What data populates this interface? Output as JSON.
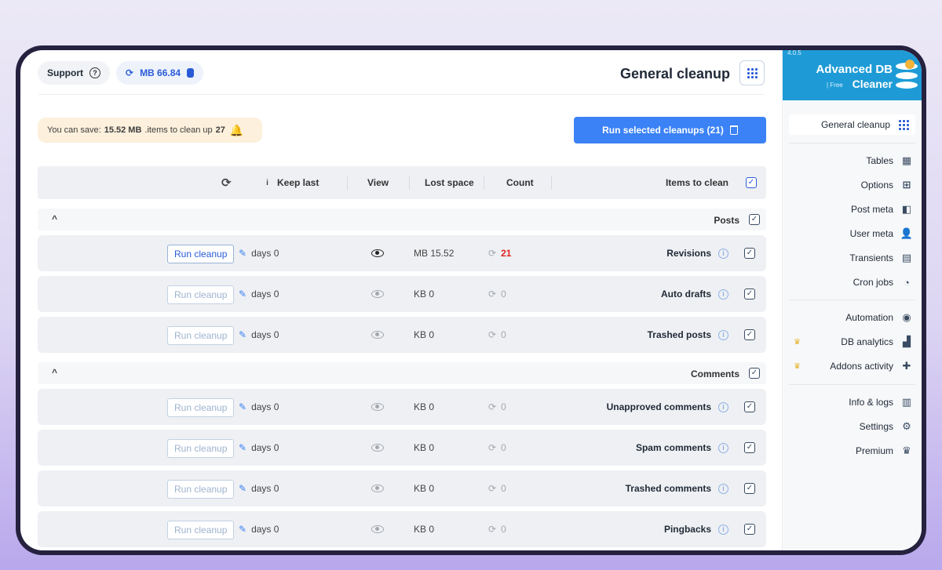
{
  "topbar": {
    "support_label": "Support",
    "db_size": "MB 66.84",
    "page_title": "General cleanup"
  },
  "banner": {
    "prefix": "You can save:",
    "save_amount": "15.52 MB",
    "middle": ".items to clean up",
    "items_count": "27"
  },
  "run_selected_label": "Run selected cleanups (21)",
  "table": {
    "headers": {
      "keep_last": "Keep last",
      "view": "View",
      "lost_space": "Lost space",
      "count": "Count",
      "items_to_clean": "Items to clean"
    },
    "run_label": "Run cleanup",
    "sections": [
      {
        "title": "Posts",
        "rows": [
          {
            "keep": "days 0",
            "space": "MB 15.52",
            "count": "21",
            "name": "Revisions"
          },
          {
            "keep": "days 0",
            "space": "KB 0",
            "count": "0",
            "name": "Auto drafts"
          },
          {
            "keep": "days 0",
            "space": "KB 0",
            "count": "0",
            "name": "Trashed posts"
          }
        ]
      },
      {
        "title": "Comments",
        "rows": [
          {
            "keep": "days 0",
            "space": "KB 0",
            "count": "0",
            "name": "Unapproved comments"
          },
          {
            "keep": "days 0",
            "space": "KB 0",
            "count": "0",
            "name": "Spam comments"
          },
          {
            "keep": "days 0",
            "space": "KB 0",
            "count": "0",
            "name": "Trashed comments"
          },
          {
            "keep": "days 0",
            "space": "KB 0",
            "count": "0",
            "name": "Pingbacks"
          }
        ]
      }
    ]
  },
  "sidebar": {
    "version": "4.0.5",
    "brand_line1": "Advanced DB",
    "brand_free": "| Free",
    "brand_line2": "Cleaner",
    "items": [
      {
        "label": "General cleanup",
        "icon": "grid-icon"
      },
      {
        "label": "Tables",
        "icon": "tables-icon"
      },
      {
        "label": "Options",
        "icon": "options-icon"
      },
      {
        "label": "Post meta",
        "icon": "post-meta-icon"
      },
      {
        "label": "User meta",
        "icon": "user-icon"
      },
      {
        "label": "Transients",
        "icon": "transients-icon"
      },
      {
        "label": "Cron jobs",
        "icon": "clock-icon"
      },
      {
        "label": "Automation",
        "icon": "automation-icon"
      },
      {
        "label": "DB analytics",
        "icon": "bar-chart-icon"
      },
      {
        "label": "Addons activity",
        "icon": "puzzle-icon"
      },
      {
        "label": "Info & logs",
        "icon": "file-icon"
      },
      {
        "label": "Settings",
        "icon": "gear-icon"
      },
      {
        "label": "Premium",
        "icon": "crown-icon"
      }
    ]
  },
  "colors": {
    "accent": "#3b82f6",
    "brand": "#1e9bd6",
    "count_alert": "#e02424",
    "banner_bg": "#fdf0dc"
  }
}
